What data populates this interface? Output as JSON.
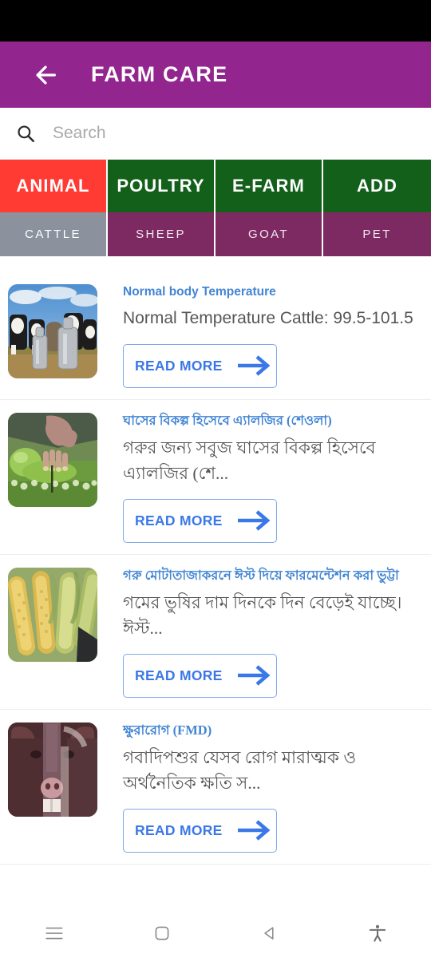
{
  "status_bar": {
    "background": "#000000"
  },
  "app_bar": {
    "title": "FARM CARE",
    "back_icon": "arrow-left-icon",
    "background": "#93258F"
  },
  "search": {
    "placeholder": "Search",
    "value": "",
    "icon": "search-icon"
  },
  "tabs_primary": {
    "active_index": 0,
    "active_color": "#FF3B33",
    "inactive_color": "#13601A",
    "items": [
      {
        "label": "ANIMAL"
      },
      {
        "label": "POULTRY"
      },
      {
        "label": "E-FARM"
      },
      {
        "label": "ADD"
      }
    ]
  },
  "tabs_secondary": {
    "active_index": 0,
    "active_color": "#8B929E",
    "inactive_color": "#7D2A63",
    "items": [
      {
        "label": "CATTLE"
      },
      {
        "label": "SHEEP"
      },
      {
        "label": "GOAT"
      },
      {
        "label": "PET"
      }
    ]
  },
  "list": {
    "read_more_label": "READ MORE",
    "items": [
      {
        "title": "Normal body Temperature",
        "text": "Normal Temperature Cattle: 99.5-101.5",
        "thumb_name": "thumb-cows-milk-cans",
        "lang": "en"
      },
      {
        "title": "ঘাসের বিকল্প হিসেবে এ্যালজির (শেওলা)",
        "text": "গরুর জন্য সবুজ ঘাসের বিকল্প হিসেবে এ্যালজির (শে...",
        "thumb_name": "thumb-algae-culture",
        "lang": "bn"
      },
      {
        "title": "গরু মোটাতাজাকরনে ঈস্ট দিয়ে ফারমেন্টেশন করা ভুট্টা",
        "text": "গমের ভুষির দাম দিনকে দিন বেড়েই যাচ্ছে।ঈস্ট...",
        "thumb_name": "thumb-corn-cobs",
        "lang": "bn"
      },
      {
        "title": "ক্ষুরারোগ (FMD)",
        "text": "গবাদিপশুর যেসব রোগ মারাত্মক ও অর্থনৈতিক ক্ষতি স...",
        "thumb_name": "thumb-cow-face",
        "lang": "bn"
      }
    ]
  },
  "bottom_nav": {
    "items": [
      {
        "icon": "menu-icon"
      },
      {
        "icon": "home-square-icon"
      },
      {
        "icon": "back-triangle-icon"
      },
      {
        "icon": "accessibility-icon"
      }
    ]
  },
  "colors": {
    "accent_purple": "#93258F",
    "tab_red": "#FF3B33",
    "tab_green": "#13601A",
    "tab_purple": "#7D2A63",
    "tab_gray": "#8B929E",
    "link_blue": "#4285D4",
    "button_blue": "#3B78E7"
  }
}
